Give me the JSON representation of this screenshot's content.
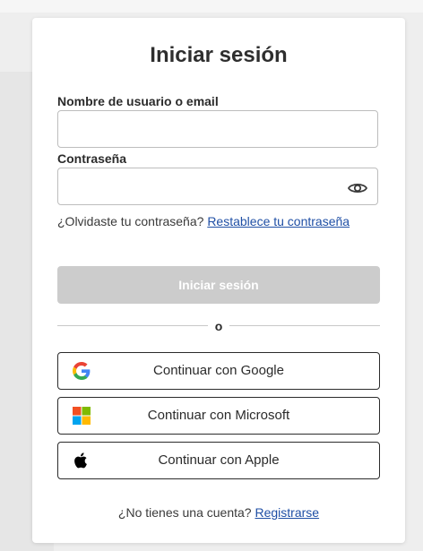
{
  "login": {
    "title": "Iniciar sesión",
    "username_label": "Nombre de usuario o email",
    "username_value": "",
    "password_label": "Contraseña",
    "password_value": "",
    "forgot_text": "¿Olvidaste tu contraseña?",
    "forgot_link": "Restablece tu contraseña",
    "submit_label": "Iniciar sesión",
    "divider_text": "o",
    "social": [
      {
        "label": "Continuar con Google",
        "icon": "google-icon"
      },
      {
        "label": "Continuar con Microsoft",
        "icon": "microsoft-icon"
      },
      {
        "label": "Continuar con Apple",
        "icon": "apple-icon"
      }
    ],
    "signup_text": "¿No tienes una cuenta?",
    "signup_link": "Registrarse"
  },
  "colors": {
    "link": "#1f4fa5",
    "submit_disabled": "#cccccc",
    "google_blue": "#4285F4",
    "google_red": "#EA4335",
    "google_yellow": "#FBBC05",
    "google_green": "#34A853",
    "ms_red": "#F25022",
    "ms_green": "#7FBA00",
    "ms_blue": "#00A4EF",
    "ms_yellow": "#FFB900"
  }
}
